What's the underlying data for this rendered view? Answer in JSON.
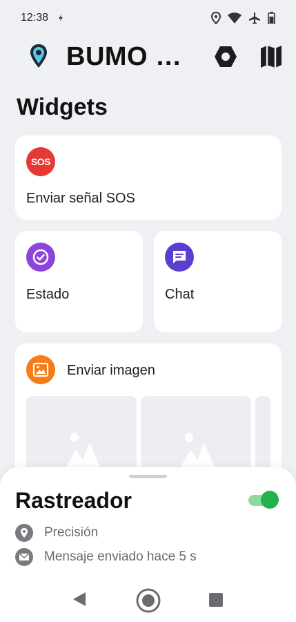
{
  "status_bar": {
    "time": "12:38",
    "icons": [
      "notification-dot-icon",
      "location-icon",
      "wifi-icon",
      "airplane-icon",
      "battery-icon"
    ]
  },
  "app_bar": {
    "title": "BUMO B...",
    "icons": [
      "bumo-logo-icon",
      "settings-hexagon-icon",
      "map-icon"
    ]
  },
  "section": {
    "title": "Widgets"
  },
  "widgets": {
    "sos": {
      "icon_text": "SOS",
      "label": "Enviar señal SOS",
      "color": "#e53935"
    },
    "estado": {
      "label": "Estado",
      "color": "#8e44d9"
    },
    "chat": {
      "label": "Chat",
      "color": "#5b3fd1"
    },
    "image": {
      "label": "Enviar imagen",
      "color": "#f57c16"
    }
  },
  "sheet": {
    "title": "Rastreador",
    "toggle_on": true,
    "toggle_color": "#22b24c",
    "rows": [
      {
        "icon": "location-pin-icon",
        "text": "Precisión"
      },
      {
        "icon": "mail-icon",
        "text": "Mensaje enviado hace 5 s"
      }
    ]
  },
  "nav": {
    "icons": [
      "back-icon",
      "home-icon",
      "recents-icon"
    ]
  }
}
